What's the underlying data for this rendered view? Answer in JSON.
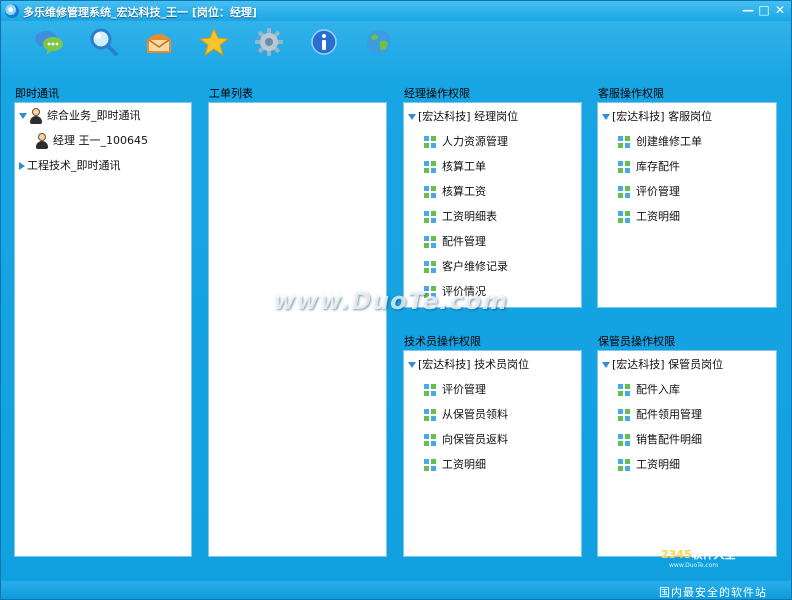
{
  "window": {
    "title": "多乐维修管理系统_宏达科技_王一 [岗位：经理]",
    "controls": [
      "—",
      "□",
      "✕"
    ]
  },
  "toolbar": {
    "tools": [
      {
        "icon": "chat-bubbles-icon"
      },
      {
        "icon": "search-icon"
      },
      {
        "icon": "mailbox-icon"
      },
      {
        "icon": "star-icon"
      },
      {
        "icon": "gear-icon"
      },
      {
        "icon": "info-icon"
      },
      {
        "icon": "globe-icon"
      }
    ]
  },
  "im": {
    "label": "即时通讯",
    "groups": [
      {
        "name": "综合业务_即时通讯",
        "expanded": true,
        "members": [
          "经理 王一_100645"
        ]
      },
      {
        "name": "工程技术_即时通讯",
        "expanded": false,
        "members": []
      }
    ]
  },
  "work_orders": {
    "label": "工单列表"
  },
  "manager_perms": {
    "label": "经理操作权限",
    "root": "[宏达科技] 经理岗位",
    "items": [
      "人力资源管理",
      "核算工单",
      "核算工资",
      "工资明细表",
      "配件管理",
      "客户维修记录",
      "评价情况"
    ]
  },
  "cs_perms": {
    "label": "客服操作权限",
    "root": "[宏达科技] 客服岗位",
    "items": [
      "创建维修工单",
      "库存配件",
      "评价管理",
      "工资明细"
    ]
  },
  "tech_perms": {
    "label": "技术员操作权限",
    "root": "[宏达科技] 技术员岗位",
    "items": [
      "评价管理",
      "从保管员领料",
      "向保管员返料",
      "工资明细"
    ]
  },
  "keeper_perms": {
    "label": "保管员操作权限",
    "root": "[宏达科技] 保管员岗位",
    "items": [
      "配件入库",
      "配件领用管理",
      "销售配件明细",
      "工资明细"
    ]
  },
  "watermark": "www.DuoTe.com",
  "footer": {
    "logo_num": "2345",
    "logo_text": "软件大全",
    "logo_url": "www.DuoTe.com",
    "slogan": "国内最安全的软件站"
  },
  "colors": {
    "background": "#12a0e0",
    "panel": "#ffffff",
    "accent": "#2b8fd0"
  }
}
